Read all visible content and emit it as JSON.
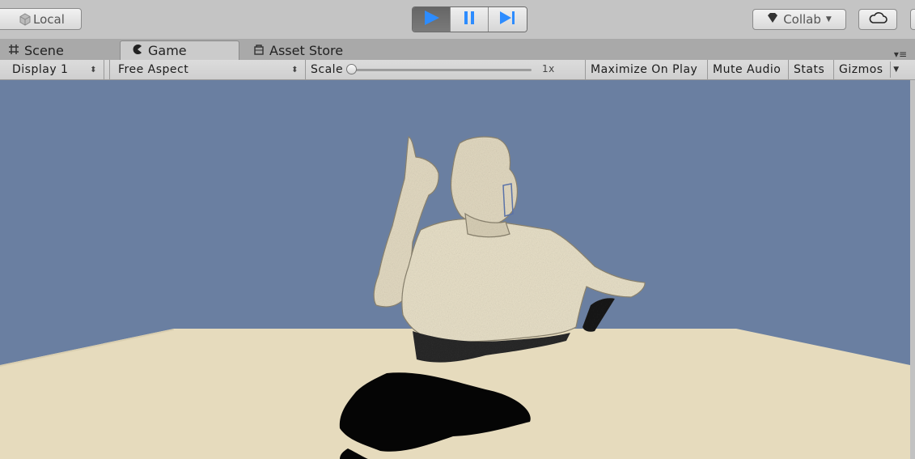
{
  "toolbar": {
    "local_label": "Local",
    "play_icon": "play-icon",
    "pause_icon": "pause-icon",
    "step_icon": "step-icon",
    "collab_label": "Collab",
    "cloud_icon": "cloud-icon"
  },
  "tabs": {
    "scene_label": "Scene",
    "game_label": "Game",
    "asset_store_label": "Asset Store"
  },
  "game_controls": {
    "display_value": "Display 1",
    "aspect_value": "Free Aspect",
    "scale_label": "Scale",
    "scale_value": "1x",
    "maximize_label": "Maximize On Play",
    "mute_label": "Mute Audio",
    "stats_label": "Stats",
    "gizmos_label": "Gizmos"
  },
  "colors": {
    "sky": "#6a7fa1",
    "ground": "#e6dbbd",
    "model": "#e8e0c8",
    "accent_play": "#2d8cff"
  }
}
